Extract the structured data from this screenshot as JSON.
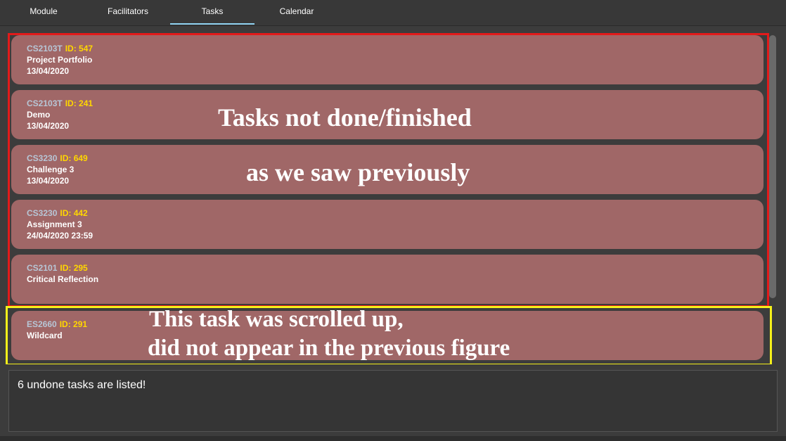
{
  "tabs": [
    {
      "label": "Module"
    },
    {
      "label": "Facilitators"
    },
    {
      "label": "Tasks"
    },
    {
      "label": "Calendar"
    }
  ],
  "active_tab": "Tasks",
  "tasks": [
    {
      "code": "CS2103T",
      "id": "ID: 547",
      "title": "Project Portfolio",
      "date": "13/04/2020"
    },
    {
      "code": "CS2103T",
      "id": "ID: 241",
      "title": "Demo",
      "date": "13/04/2020"
    },
    {
      "code": "CS3230",
      "id": "ID: 649",
      "title": "Challenge 3",
      "date": "13/04/2020"
    },
    {
      "code": "CS3230",
      "id": "ID: 442",
      "title": "Assignment 3",
      "date": "24/04/2020 23:59"
    },
    {
      "code": "CS2101",
      "id": "ID: 295",
      "title": "Critical Reflection",
      "date": ""
    },
    {
      "code": "ES2660",
      "id": "ID: 291",
      "title": "Wildcard",
      "date": ""
    }
  ],
  "annotations": {
    "red_line1": "Tasks not done/finished",
    "red_line2": "as we saw previously",
    "yellow_line1": "This task was scrolled up,",
    "yellow_line2": "did not appear in the previous figure"
  },
  "result_message": "6 undone tasks are listed!",
  "colors": {
    "card": "#a06767",
    "module_code": "#b7c6d6",
    "task_id": "#ffd700",
    "active_tab_underline": "#8fd2f0",
    "annotation_red": "#e21a1a",
    "annotation_yellow": "#f5f01a"
  }
}
